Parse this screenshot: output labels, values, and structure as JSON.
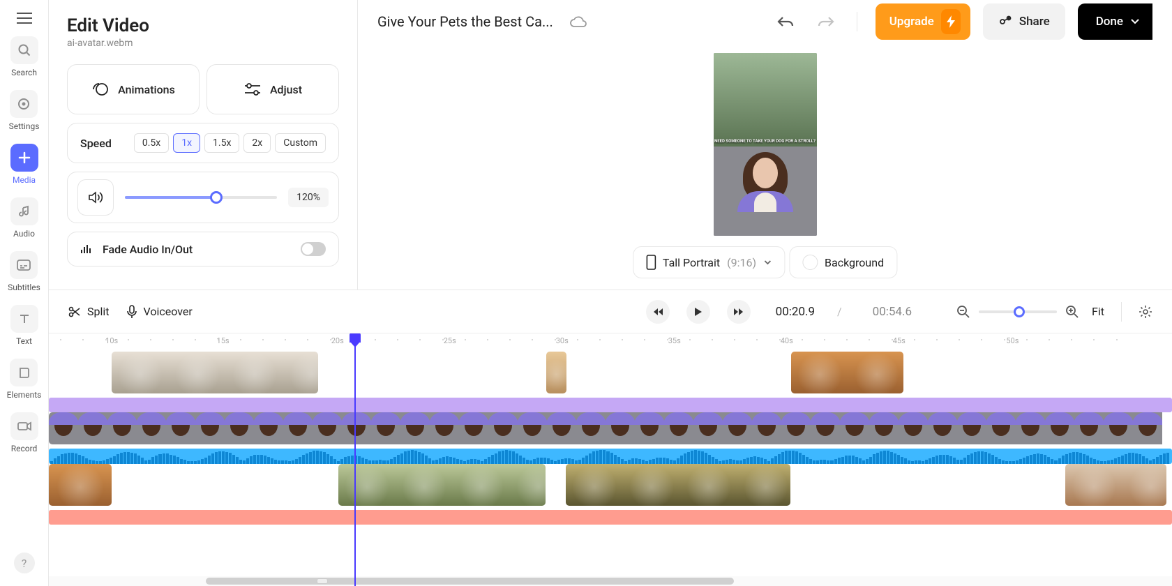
{
  "sidebar": {
    "items": [
      {
        "label": "Search"
      },
      {
        "label": "Settings"
      },
      {
        "label": "Media"
      },
      {
        "label": "Audio"
      },
      {
        "label": "Subtitles"
      },
      {
        "label": "Text"
      },
      {
        "label": "Elements"
      },
      {
        "label": "Record"
      }
    ]
  },
  "edit": {
    "title": "Edit Video",
    "subtitle": "ai-avatar.webm",
    "animations": "Animations",
    "adjust": "Adjust",
    "speed_label": "Speed",
    "speeds": [
      "0.5x",
      "1x",
      "1.5x",
      "2x",
      "Custom"
    ],
    "speed_selected": "1x",
    "volume_pct": "120%",
    "volume_slider": 60,
    "fade_label": "Fade Audio In/Out",
    "fade_on": false
  },
  "header": {
    "project_title": "Give Your Pets the Best Ca...",
    "upgrade": "Upgrade",
    "share": "Share",
    "done": "Done"
  },
  "preview": {
    "caption": "NEED SOMEONE TO TAKE YOUR DOG FOR A STROLL?",
    "aspect_label": "Tall Portrait",
    "aspect_ratio": "(9:16)",
    "background_label": "Background"
  },
  "timeline_bar": {
    "split": "Split",
    "voiceover": "Voiceover",
    "current": "00:20.9",
    "total": "00:54.6",
    "fit": "Fit",
    "zoom": 52
  },
  "ruler_marks": [
    "10s",
    "15s",
    "20s",
    "25s",
    "30s",
    "35s",
    "40s",
    "45s",
    "50s"
  ],
  "playhead_pct": 27.2
}
